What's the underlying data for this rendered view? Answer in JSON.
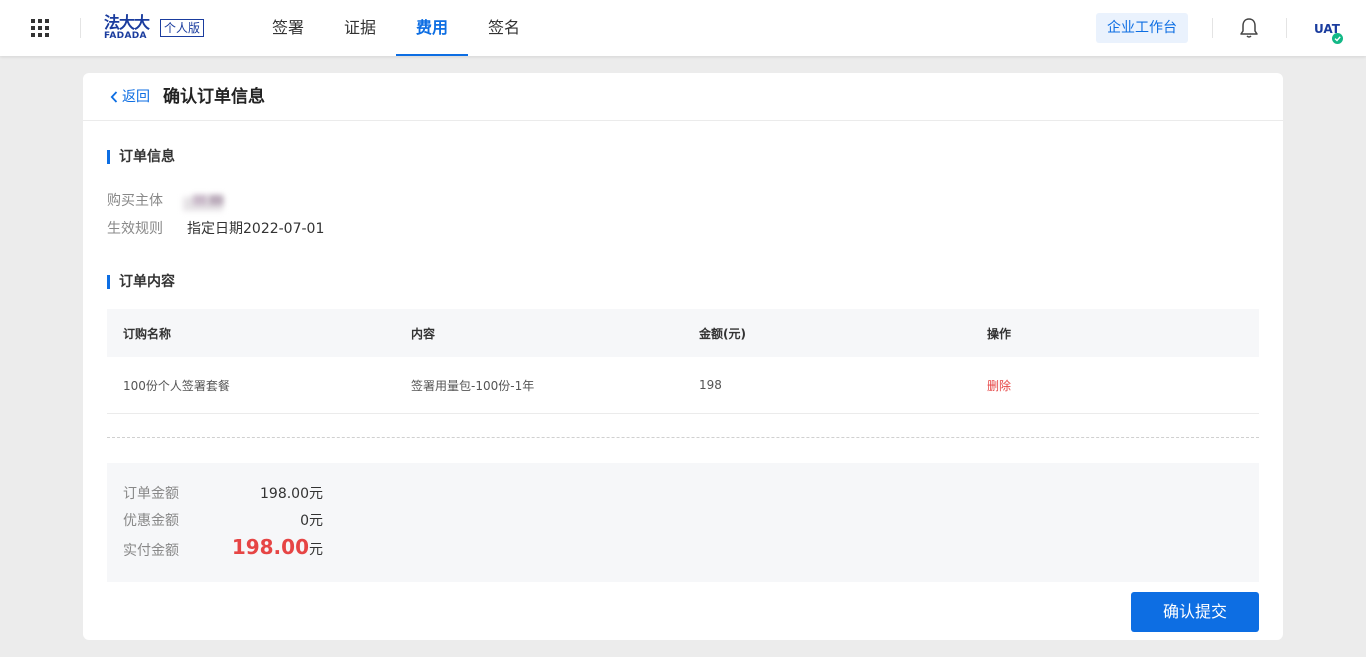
{
  "header": {
    "logo_text_cn": "法大大",
    "logo_text_en": "FADADA",
    "edition_label": "个人版",
    "nav_tabs": [
      {
        "label": "签署",
        "active": false
      },
      {
        "label": "证据",
        "active": false
      },
      {
        "label": "费用",
        "active": true
      },
      {
        "label": "签名",
        "active": false
      }
    ],
    "workbench_label": "企业工作台",
    "user_badge": "UAT"
  },
  "page": {
    "back_label": "返回",
    "title": "确认订单信息"
  },
  "order_info": {
    "section_title": "订单信息",
    "buyer_label": "购买主体",
    "rule_label": "生效规则",
    "rule_value": "指定日期2022-07-01"
  },
  "order_content": {
    "section_title": "订单内容",
    "columns": [
      "订购名称",
      "内容",
      "金额(元)",
      "操作"
    ],
    "rows": [
      {
        "name": "100份个人签署套餐",
        "content": "签署用量包-100份-1年",
        "amount": "198",
        "action": "删除"
      }
    ]
  },
  "summary": {
    "order_amount_label": "订单金额",
    "order_amount_value": "198.00元",
    "discount_label": "优惠金额",
    "discount_value": "0元",
    "paid_label": "实付金额",
    "paid_value": "198.00",
    "paid_unit": "元"
  },
  "actions": {
    "submit_label": "确认提交"
  },
  "colors": {
    "primary": "#0d6ee3",
    "danger": "#e64545",
    "brand": "#1a3c9e"
  }
}
